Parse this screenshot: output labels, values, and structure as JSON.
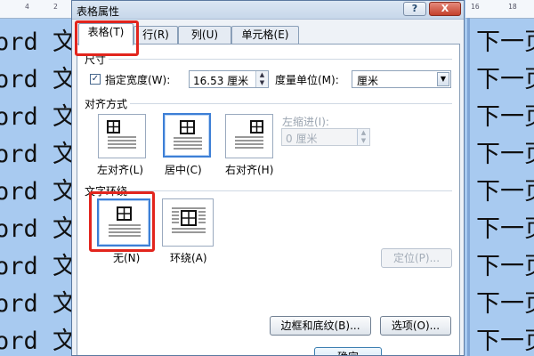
{
  "document": {
    "left_lines": [
      "ord 文",
      "ord 文",
      "ord 文",
      "ord 文",
      "ord 文",
      "ord 文",
      "ord 文",
      "ord 文",
      "ord 文"
    ],
    "right_lines": [
      "下一页",
      "下一页",
      "下一页",
      "下一页",
      "下一页",
      "下一页",
      "下一页",
      "下一页",
      "下一页"
    ],
    "ruler_left": [
      "4",
      "2"
    ],
    "ruler_right": [
      "16",
      "18"
    ]
  },
  "dialog": {
    "title": "表格属性",
    "help_label": "?",
    "close_label": "X",
    "tabs": [
      {
        "label": "表格(T)",
        "active": true
      },
      {
        "label": "行(R)",
        "active": false
      },
      {
        "label": "列(U)",
        "active": false
      },
      {
        "label": "单元格(E)",
        "active": false
      }
    ],
    "size": {
      "group_label": "尺寸",
      "preferred_width_checked": true,
      "check_mark": "✓",
      "preferred_width_label": "指定宽度(W):",
      "preferred_width_value": "16.53 厘米",
      "measure_in_label": "度量单位(M):",
      "measure_in_value": "厘米"
    },
    "alignment": {
      "group_label": "对齐方式",
      "options": [
        {
          "label": "左对齐(L)",
          "selected": false
        },
        {
          "label": "居中(C)",
          "selected": true
        },
        {
          "label": "右对齐(H)",
          "selected": false
        }
      ],
      "indent_label": "左缩进(I):",
      "indent_value": "0 厘米"
    },
    "wrapping": {
      "group_label": "文字环绕",
      "options": [
        {
          "label": "无(N)",
          "selected": true
        },
        {
          "label": "环绕(A)",
          "selected": false
        }
      ],
      "positioning_button": "定位(P)..."
    },
    "buttons": {
      "borders_shading": "边框和底纹(B)...",
      "options": "选项(O)...",
      "ok": "确定"
    }
  },
  "colors": {
    "highlight": "#e2251d",
    "selection_blue": "#3d7fd6",
    "document_bg": "#a8caf0"
  }
}
